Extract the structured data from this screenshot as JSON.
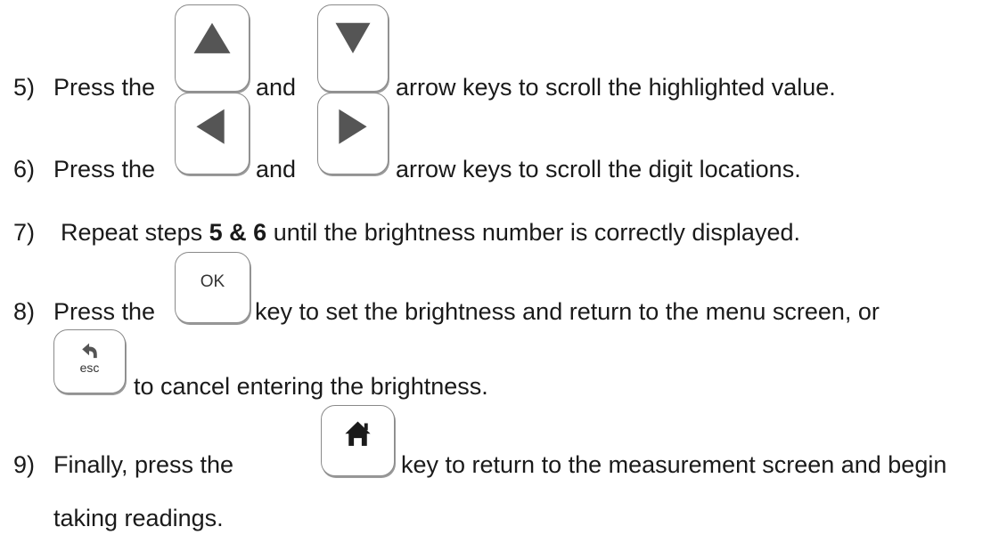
{
  "steps": [
    {
      "number": "5)",
      "text_before": "Press the",
      "text_middle": "and",
      "text_after": "arrow keys to scroll the highlighted value.",
      "key1_icon": "up-arrow-icon",
      "key2_icon": "down-arrow-icon"
    },
    {
      "number": "6)",
      "text_before": "Press the",
      "text_middle": "and",
      "text_after": "arrow keys to scroll the digit locations.",
      "key1_icon": "left-arrow-icon",
      "key2_icon": "right-arrow-icon"
    },
    {
      "number": "7)",
      "text_before": "Repeat steps",
      "text_bold": "5 & 6",
      "text_after": "until the brightness number is correctly displayed."
    },
    {
      "number": "8)",
      "text_before": "Press the",
      "text_after": "key to set the brightness and return to the menu screen, or",
      "key_label": "OK",
      "line2_after": "to cancel entering the brightness.",
      "esc_label": "esc",
      "esc_icon": "back-arrow-icon"
    },
    {
      "number": "9)",
      "text_before": "Finally, press the",
      "text_after": "key to return to the measurement screen and begin",
      "line2": "taking readings.",
      "key_icon": "home-icon"
    }
  ],
  "colors": {
    "text": "#1a1a1a",
    "key_border": "#8a8a8a",
    "key_icon": "#555555"
  }
}
